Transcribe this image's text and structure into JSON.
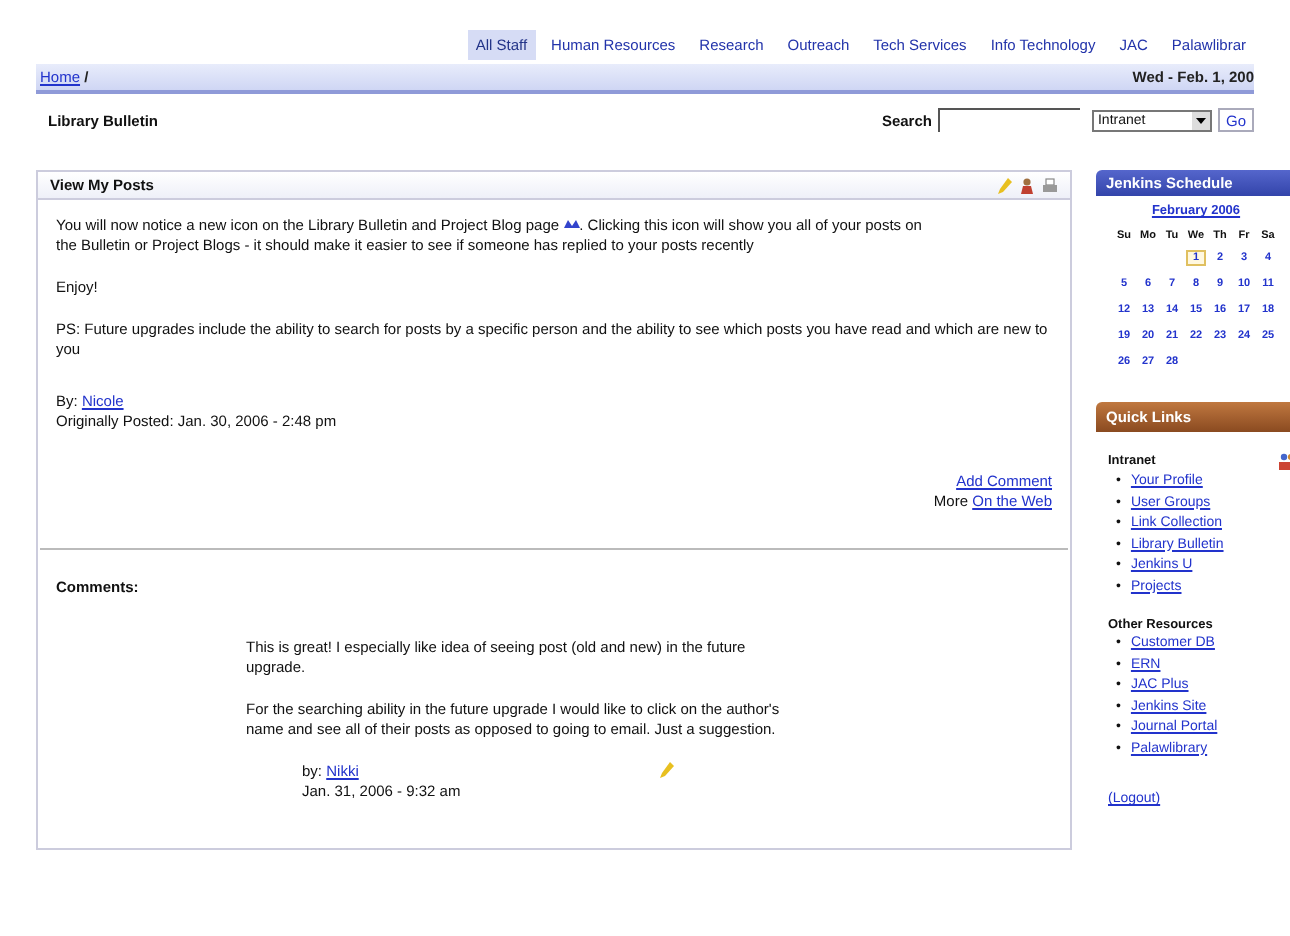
{
  "tabs": [
    {
      "label": "All Staff",
      "selected": true
    },
    {
      "label": "Human Resources",
      "selected": false
    },
    {
      "label": "Research",
      "selected": false
    },
    {
      "label": "Outreach",
      "selected": false
    },
    {
      "label": "Tech Services",
      "selected": false
    },
    {
      "label": "Info Technology",
      "selected": false
    },
    {
      "label": "JAC",
      "selected": false
    },
    {
      "label": "Palawlibrar",
      "selected": false
    }
  ],
  "breadcrumb": {
    "link": "Home",
    "separator": "/",
    "date": "Wed - Feb. 1, 200"
  },
  "page_title": "Library Bulletin",
  "search": {
    "label": "Search",
    "scope": "Intranet",
    "button": "Go"
  },
  "post": {
    "title": "View My Posts",
    "intro_before_icon": "You will now notice a new icon on the Library Bulletin and Project Blog page",
    "intro_after_icon": ".  Clicking this icon will show you all of your posts on",
    "intro_continued": "the Bulletin or Project Blogs - it should make it easier to see if someone has replied to your posts recently",
    "paragraphs": [
      "Enjoy!",
      "PS: Future upgrades include the ability to search for posts by a specific person and the ability to see which posts you have read and which are new to you"
    ],
    "by_label": "By:",
    "author": "Nicole",
    "posted": "Originally Posted: Jan. 30, 2006 - 2:48 pm",
    "add_comment": "Add Comment",
    "more_label": "More",
    "more_link": "On the Web"
  },
  "comments": {
    "heading": "Comments:",
    "items": [
      {
        "paragraphs": [
          "This is great! I especially like idea of seeing post (old and new) in the future upgrade.",
          "For the searching ability in the future upgrade I would like to click on the author's name and see all of their posts as opposed to going to email. Just a suggestion."
        ],
        "by_label": "by:",
        "author": "Nikki",
        "date": "Jan. 31, 2006 - 9:32 am"
      }
    ]
  },
  "schedule": {
    "title": "Jenkins Schedule",
    "month": "February 2006",
    "weekdays": [
      "Su",
      "Mo",
      "Tu",
      "We",
      "Th",
      "Fr",
      "Sa"
    ],
    "weeks": [
      {
        "kind": "opening",
        "days": [
          {
            "day": "1",
            "today": true
          },
          {
            "day": "2",
            "today": false
          },
          {
            "day": "3",
            "today": false
          },
          {
            "day": "4",
            "today": false
          }
        ]
      },
      {
        "kind": "full",
        "days": [
          {
            "day": "5",
            "today": false
          },
          {
            "day": "6",
            "today": false
          },
          {
            "day": "7",
            "today": false
          },
          {
            "day": "8",
            "today": false
          },
          {
            "day": "9",
            "today": false
          },
          {
            "day": "10",
            "today": false
          },
          {
            "day": "11",
            "today": false
          }
        ]
      },
      {
        "kind": "full",
        "days": [
          {
            "day": "12",
            "today": false
          },
          {
            "day": "13",
            "today": false
          },
          {
            "day": "14",
            "today": false
          },
          {
            "day": "15",
            "today": false
          },
          {
            "day": "16",
            "today": false
          },
          {
            "day": "17",
            "today": false
          },
          {
            "day": "18",
            "today": false
          }
        ]
      },
      {
        "kind": "full",
        "days": [
          {
            "day": "19",
            "today": false
          },
          {
            "day": "20",
            "today": false
          },
          {
            "day": "21",
            "today": false
          },
          {
            "day": "22",
            "today": false
          },
          {
            "day": "23",
            "today": false
          },
          {
            "day": "24",
            "today": false
          },
          {
            "day": "25",
            "today": false
          }
        ]
      },
      {
        "kind": "closing",
        "days": [
          {
            "day": "26",
            "today": false
          },
          {
            "day": "27",
            "today": false
          },
          {
            "day": "28",
            "today": false
          }
        ]
      }
    ]
  },
  "quick_links": {
    "title": "Quick Links",
    "groups": [
      {
        "heading": "Intranet",
        "bullet": "•",
        "links": [
          "Your Profile",
          "User Groups",
          "Link Collection",
          "Library Bulletin",
          "Jenkins U",
          "Projects"
        ]
      },
      {
        "heading": "Other Resources",
        "bullet": "•",
        "links": [
          "Customer DB",
          "ERN",
          "JAC Plus",
          "Jenkins Site",
          "Journal Portal",
          "Palawlibrary"
        ]
      }
    ],
    "logout": "(Logout)"
  }
}
